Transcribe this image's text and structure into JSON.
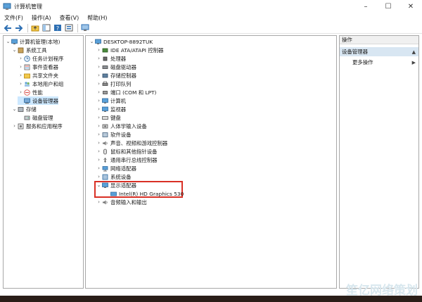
{
  "window": {
    "title": "计算机管理",
    "controls": [
      "–",
      "☐",
      "✕"
    ]
  },
  "menu": [
    "文件(F)",
    "操作(A)",
    "查看(V)",
    "帮助(H)"
  ],
  "left_tree": [
    {
      "label": "计算机管理(本地)",
      "level": 0,
      "expander": "⌄",
      "icon": "computer-icon"
    },
    {
      "label": "系统工具",
      "level": 1,
      "expander": "⌄",
      "icon": "tools-icon"
    },
    {
      "label": "任务计划程序",
      "level": 2,
      "expander": "›",
      "icon": "clock-icon"
    },
    {
      "label": "事件查看器",
      "level": 2,
      "expander": "›",
      "icon": "event-icon"
    },
    {
      "label": "共享文件夹",
      "level": 2,
      "expander": "›",
      "icon": "folder-icon"
    },
    {
      "label": "本地用户和组",
      "level": 2,
      "expander": "›",
      "icon": "users-icon"
    },
    {
      "label": "性能",
      "level": 2,
      "expander": "›",
      "icon": "performance-icon"
    },
    {
      "label": "设备管理器",
      "level": 2,
      "expander": "",
      "icon": "device-manager-icon",
      "selected": true
    },
    {
      "label": "存储",
      "level": 1,
      "expander": "⌄",
      "icon": "storage-icon"
    },
    {
      "label": "磁盘管理",
      "level": 2,
      "expander": "",
      "icon": "disk-icon"
    },
    {
      "label": "服务和应用程序",
      "level": 1,
      "expander": "›",
      "icon": "services-icon"
    }
  ],
  "device_tree": {
    "root": "DESKTOP-8892TUK",
    "categories": [
      {
        "label": "IDE ATA/ATAPI 控制器",
        "icon": "ide-icon"
      },
      {
        "label": "处理器",
        "icon": "processor-icon"
      },
      {
        "label": "磁盘驱动器",
        "icon": "disk-drive-icon"
      },
      {
        "label": "存储控制器",
        "icon": "storage-controller-icon"
      },
      {
        "label": "打印队列",
        "icon": "printer-icon"
      },
      {
        "label": "端口 (COM 和 LPT)",
        "icon": "port-icon"
      },
      {
        "label": "计算机",
        "icon": "computer-icon"
      },
      {
        "label": "监视器",
        "icon": "monitor-icon"
      },
      {
        "label": "键盘",
        "icon": "keyboard-icon"
      },
      {
        "label": "人体学输入设备",
        "icon": "hid-icon"
      },
      {
        "label": "软件设备",
        "icon": "software-device-icon"
      },
      {
        "label": "声音、视频和游戏控制器",
        "icon": "sound-icon"
      },
      {
        "label": "鼠标和其他指针设备",
        "icon": "mouse-icon"
      },
      {
        "label": "通用串行总线控制器",
        "icon": "usb-icon"
      },
      {
        "label": "网络适配器",
        "icon": "network-icon"
      },
      {
        "label": "系统设备",
        "icon": "system-device-icon"
      },
      {
        "label": "显示适配器",
        "icon": "display-adapter-icon",
        "expanded": true
      },
      {
        "label": "Intel(R) HD Graphics 530",
        "icon": "gpu-icon",
        "child": true
      },
      {
        "label": "音频输入和输出",
        "icon": "audio-icon"
      }
    ]
  },
  "actions": {
    "header": "操作",
    "items": [
      {
        "label": "设备管理器",
        "arrow": "▲"
      },
      {
        "label": "更多操作",
        "arrow": "▶"
      }
    ]
  },
  "watermark": "笙亿网络策划",
  "colors": {
    "selection": "#cde8ff",
    "highlight_box": "#d93025",
    "pane_border": "#a8a8a8"
  }
}
